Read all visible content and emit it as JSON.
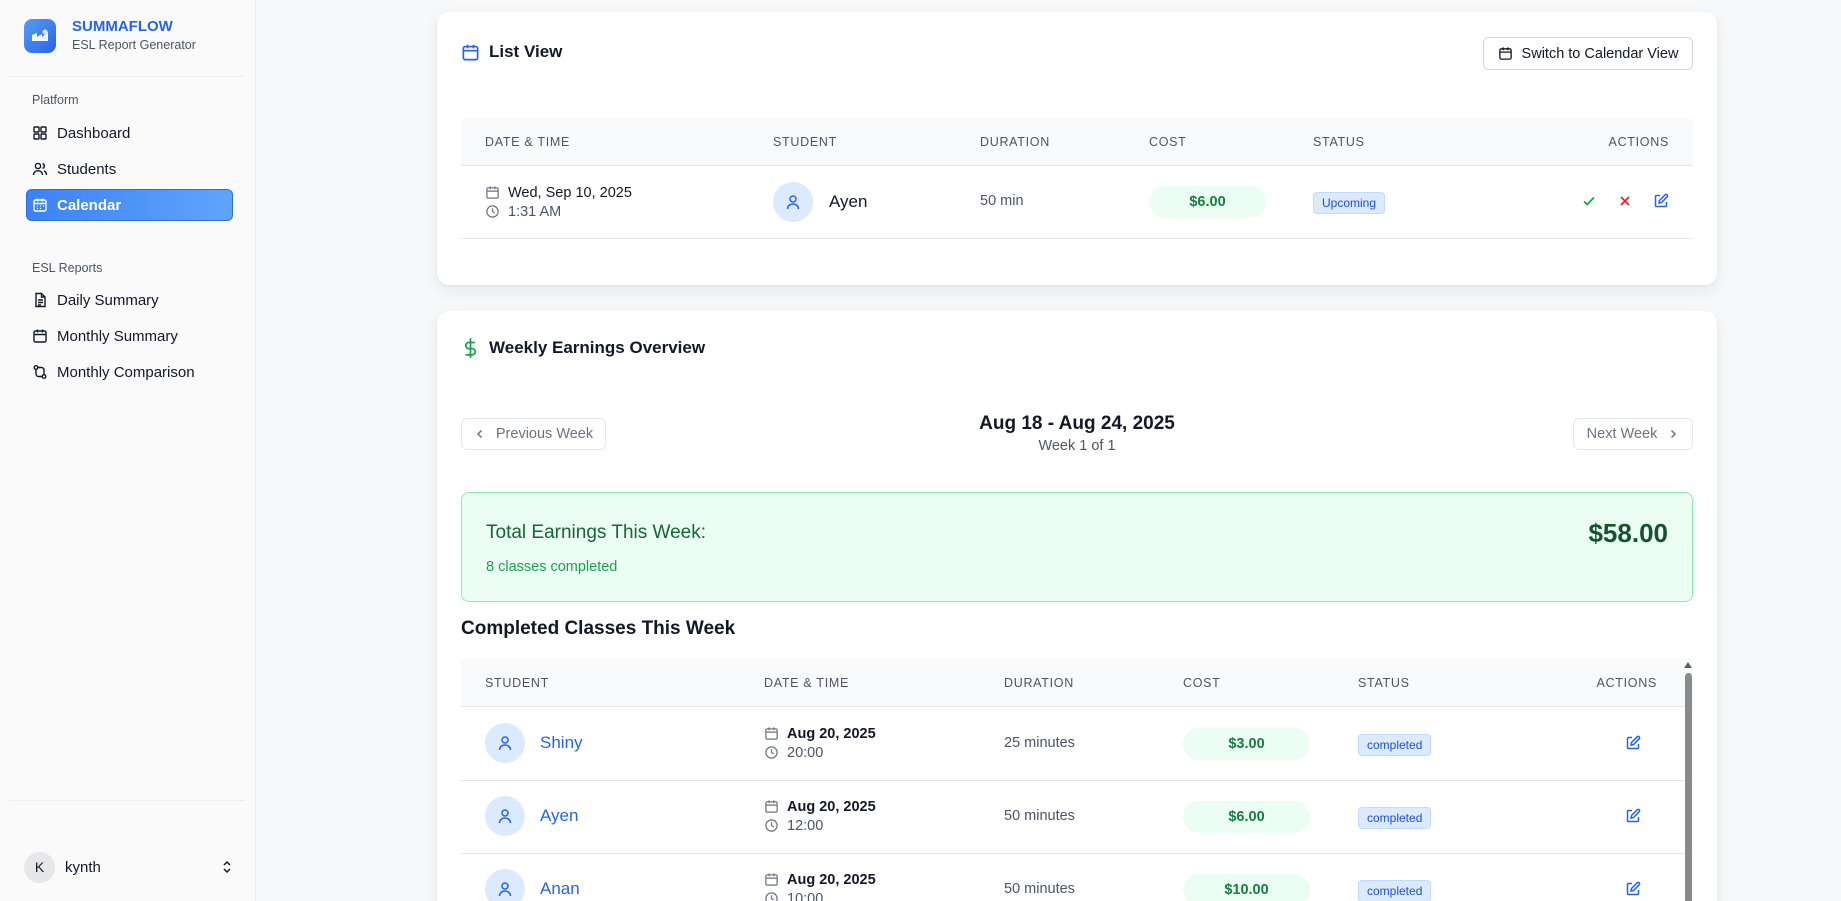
{
  "brand": {
    "name": "SUMMAFLOW",
    "subtitle": "ESL Report Generator"
  },
  "sidebar": {
    "platform_label": "Platform",
    "platform_items": [
      {
        "label": "Dashboard",
        "icon": "grid-icon"
      },
      {
        "label": "Students",
        "icon": "users-icon"
      },
      {
        "label": "Calendar",
        "icon": "calendar-icon",
        "active": true
      }
    ],
    "reports_label": "ESL Reports",
    "report_items": [
      {
        "label": "Daily Summary",
        "icon": "file-text-icon"
      },
      {
        "label": "Monthly Summary",
        "icon": "calendar-icon"
      },
      {
        "label": "Monthly Comparison",
        "icon": "git-compare-icon"
      }
    ],
    "user": {
      "initial": "K",
      "name": "kynth"
    }
  },
  "list_view": {
    "title": "List View",
    "switch_button": "Switch to Calendar View",
    "headers": [
      "DATE & TIME",
      "STUDENT",
      "DURATION",
      "COST",
      "STATUS",
      "ACTIONS"
    ],
    "rows": [
      {
        "date": "Wed, Sep 10, 2025",
        "time": "1:31 AM",
        "student": "Ayen",
        "duration": "50 min",
        "cost": "$6.00",
        "status": "Upcoming"
      }
    ]
  },
  "weekly": {
    "title": "Weekly Earnings Overview",
    "prev_button": "Previous Week",
    "next_button": "Next Week",
    "range": "Aug 18 - Aug 24, 2025",
    "week_label": "Week 1 of 1",
    "total_label": "Total Earnings This Week:",
    "total_value": "$58.00",
    "classes_completed": "8 classes completed",
    "completed_title": "Completed Classes This Week",
    "headers": [
      "STUDENT",
      "DATE & TIME",
      "DURATION",
      "COST",
      "STATUS",
      "ACTIONS"
    ],
    "rows": [
      {
        "student": "Shiny",
        "date": "Aug 20, 2025",
        "time": "20:00",
        "duration": "25 minutes",
        "cost": "$3.00",
        "status": "completed"
      },
      {
        "student": "Ayen",
        "date": "Aug 20, 2025",
        "time": "12:00",
        "duration": "50 minutes",
        "cost": "$6.00",
        "status": "completed"
      },
      {
        "student": "Anan",
        "date": "Aug 20, 2025",
        "time": "10:00",
        "duration": "50 minutes",
        "cost": "$10.00",
        "status": "completed"
      }
    ]
  },
  "colors": {
    "accent": "#2563eb",
    "success": "#15803d",
    "danger": "#dc2626",
    "success_bg": "#ecfdf3"
  }
}
